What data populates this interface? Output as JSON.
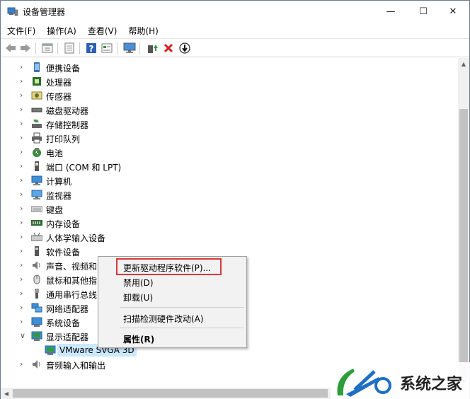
{
  "window": {
    "title": "设备管理器",
    "controls": {
      "minimize": "—",
      "maximize": "☐",
      "close": "✕"
    }
  },
  "menubar": {
    "items": [
      {
        "label": "文件(F)"
      },
      {
        "label": "操作(A)"
      },
      {
        "label": "查看(V)"
      },
      {
        "label": "帮助(H)"
      }
    ]
  },
  "toolbar": {
    "buttons": [
      "back-icon",
      "forward-icon",
      "properties-icon",
      "view-icon",
      "help-icon",
      "details-icon",
      "monitor-icon",
      "update-driver-icon",
      "uninstall-icon",
      "download-icon"
    ]
  },
  "tree": {
    "items": [
      {
        "label": "便携设备",
        "icon": "portable-device-icon",
        "expanded": false
      },
      {
        "label": "处理器",
        "icon": "processor-icon",
        "expanded": false
      },
      {
        "label": "传感器",
        "icon": "sensor-icon",
        "expanded": false
      },
      {
        "label": "磁盘驱动器",
        "icon": "disk-drive-icon",
        "expanded": false
      },
      {
        "label": "存储控制器",
        "icon": "storage-controller-icon",
        "expanded": false
      },
      {
        "label": "打印队列",
        "icon": "printer-icon",
        "expanded": false
      },
      {
        "label": "电池",
        "icon": "battery-icon",
        "expanded": false
      },
      {
        "label": "端口 (COM 和 LPT)",
        "icon": "port-icon",
        "expanded": false
      },
      {
        "label": "计算机",
        "icon": "computer-icon",
        "expanded": false
      },
      {
        "label": "监视器",
        "icon": "monitor-icon",
        "expanded": false
      },
      {
        "label": "键盘",
        "icon": "keyboard-icon",
        "expanded": false
      },
      {
        "label": "内存设备",
        "icon": "memory-icon",
        "expanded": false
      },
      {
        "label": "人体学输入设备",
        "icon": "hid-icon",
        "expanded": false
      },
      {
        "label": "软件设备",
        "icon": "software-device-icon",
        "expanded": false
      },
      {
        "label": "声音、视频和游",
        "icon": "audio-icon",
        "expanded": false
      },
      {
        "label": "鼠标和其他指",
        "icon": "mouse-icon",
        "expanded": false
      },
      {
        "label": "通用串行总线",
        "icon": "usb-icon",
        "expanded": false
      },
      {
        "label": "网络适配器",
        "icon": "network-icon",
        "expanded": false
      },
      {
        "label": "系统设备",
        "icon": "system-device-icon",
        "expanded": false
      },
      {
        "label": "显示适配器",
        "icon": "display-adapter-icon",
        "expanded": true
      },
      {
        "label": "音频输入和输出",
        "icon": "audio-io-icon",
        "expanded": false
      }
    ],
    "selected_child": {
      "label": "VMware SVGA 3D",
      "icon": "display-adapter-icon"
    }
  },
  "context_menu": {
    "items": [
      {
        "label": "更新驱动程序软件(P)...",
        "highlighted": true
      },
      {
        "label": "禁用(D)"
      },
      {
        "label": "卸载(U)"
      },
      {
        "label": "扫描检测硬件改动(A)"
      },
      {
        "label": "属性(R)",
        "bold": true
      }
    ]
  },
  "watermark": {
    "text": "系统之家"
  },
  "colors": {
    "selection": "#cce8ff",
    "highlight_border": "#d9383a",
    "menu_bg": "#f2f2f2"
  }
}
